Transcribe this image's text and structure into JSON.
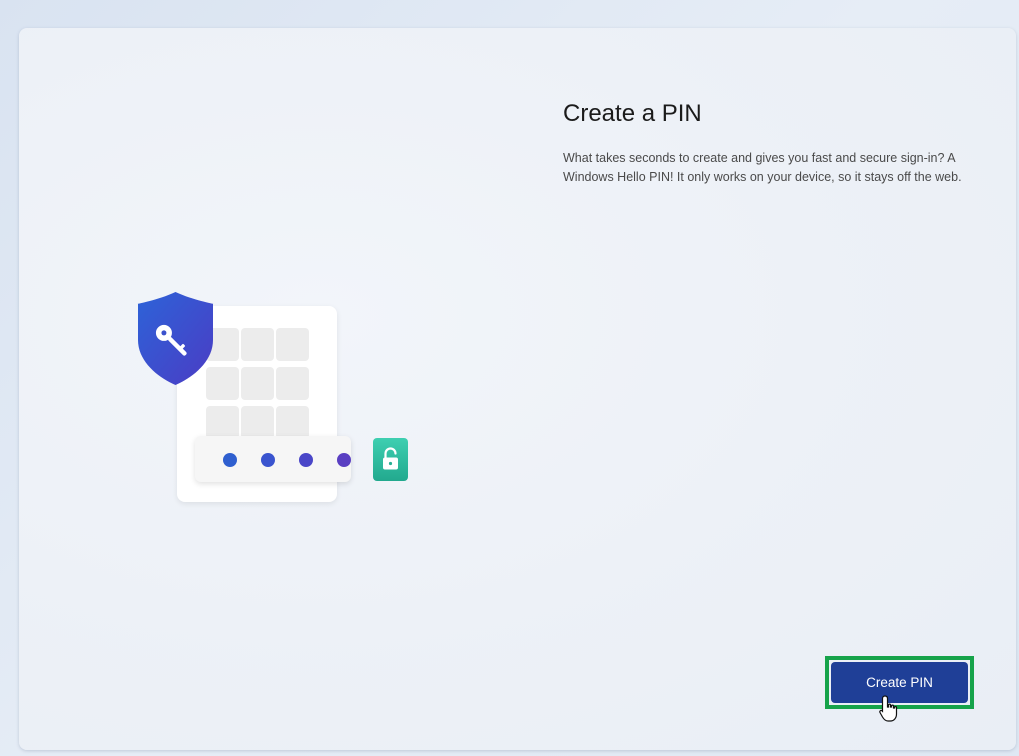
{
  "page": {
    "title": "Create a PIN",
    "description": "What takes seconds to create and gives you fast and secure sign-in? A Windows Hello PIN! It only works on your device, so it stays off the web."
  },
  "illustration": {
    "shield_icon": "key-shield-icon",
    "lock_icon": "unlocked-padlock-icon",
    "pin_dot_colors": [
      "#2f5fcf",
      "#3a54cf",
      "#4a46c8",
      "#5a3fc2"
    ]
  },
  "actions": {
    "primary_label": "Create PIN"
  },
  "colors": {
    "accent": "#1f3f97",
    "highlight": "#16a34a"
  }
}
